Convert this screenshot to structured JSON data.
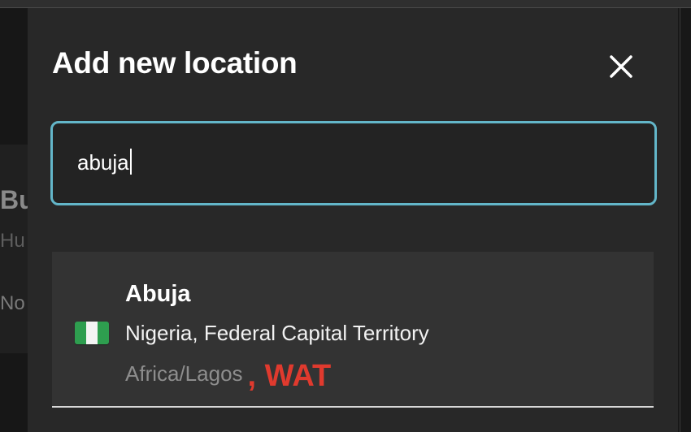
{
  "background": {
    "title_fragment": "Bu",
    "subtitle_fragment": "Hu",
    "note_fragment": "No"
  },
  "dialog": {
    "title": "Add new location",
    "close_icon": "close-icon"
  },
  "search": {
    "value": "abuja",
    "accent_color": "#63b6c9"
  },
  "results": [
    {
      "flag_icon": "nigeria-flag-icon",
      "city": "Abuja",
      "region": "Nigeria, Federal Capital Territory",
      "timezone": "Africa/Lagos",
      "abbreviation": ", WAT",
      "abbreviation_color": "#e03a2e"
    }
  ]
}
